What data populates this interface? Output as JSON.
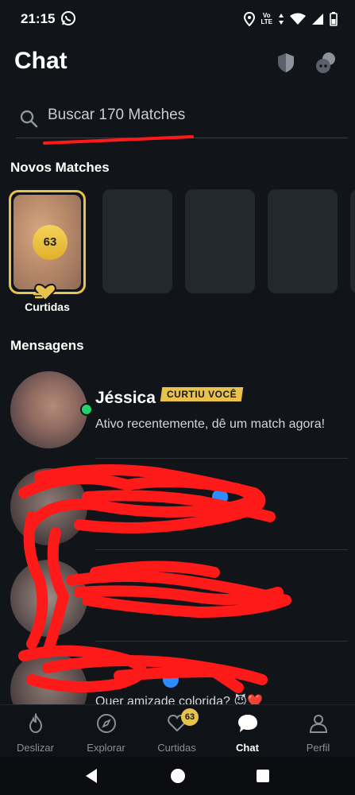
{
  "status_bar": {
    "time": "21:15",
    "app_icon": "whatsapp-icon",
    "volte_top": "Vo",
    "volte_bottom": "LTE",
    "icons": [
      "location-icon",
      "volte-icon",
      "data-arrows-icon",
      "wifi-icon",
      "signal-icon",
      "battery-icon"
    ]
  },
  "header": {
    "title": "Chat",
    "shield_icon": "shield-icon",
    "explore_icon": "explore-bubbles-icon"
  },
  "search": {
    "placeholder": "Buscar 170 Matches",
    "icon": "search-icon"
  },
  "new_matches": {
    "title": "Novos Matches",
    "likes_card": {
      "count": "63",
      "label": "Curtidas",
      "accent": "#e8c24a"
    },
    "placeholder_cards": 4
  },
  "messages": {
    "title": "Mensagens",
    "items": [
      {
        "name": "Jéssica",
        "badge": "CURTIU VOCÊ",
        "preview": "Ativo recentemente, dê um match agora!",
        "online": true
      },
      {
        "name": "",
        "preview": "",
        "verified": true,
        "redacted": true
      },
      {
        "name": "",
        "preview": "",
        "redacted": true
      },
      {
        "name": "",
        "preview": "Quer amizade colorida? 😈❤️",
        "verified": true,
        "redacted": true
      }
    ]
  },
  "bottom_nav": {
    "items": [
      {
        "label": "Deslizar",
        "icon": "flame-icon",
        "active": false
      },
      {
        "label": "Explorar",
        "icon": "compass-icon",
        "active": false
      },
      {
        "label": "Curtidas",
        "icon": "heart-icon",
        "active": false,
        "badge": "63"
      },
      {
        "label": "Chat",
        "icon": "chat-bubble-icon",
        "active": true
      },
      {
        "label": "Perfil",
        "icon": "profile-icon",
        "active": false
      }
    ]
  },
  "system_nav": {
    "back": "back-icon",
    "home": "home-icon",
    "recents": "recents-icon"
  },
  "colors": {
    "background": "#111418",
    "gold": "#e8c24a",
    "online": "#21d36b",
    "verified": "#2d8cff",
    "redaction": "#ff1a1a"
  }
}
